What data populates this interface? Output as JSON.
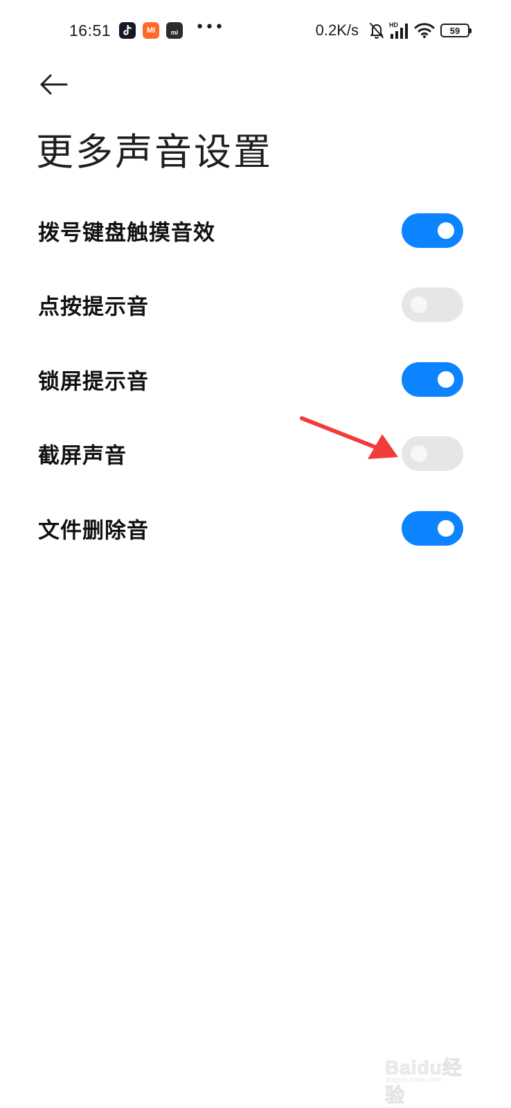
{
  "status_bar": {
    "time": "16:51",
    "app_icons": [
      "tiktok-icon",
      "mi-app-icon",
      "mi-store-icon"
    ],
    "mi_label": "MI",
    "mi_store_label": "mi",
    "more": "•••",
    "net_speed": "0.2K/s",
    "battery": "59",
    "icons": [
      "bell-off-icon",
      "hd-signal-icon",
      "wifi-icon",
      "battery-icon"
    ]
  },
  "header": {
    "back_icon": "arrow-left-icon",
    "title": "更多声音设置"
  },
  "settings": [
    {
      "label": "拨号键盘触摸音效",
      "enabled": true
    },
    {
      "label": "点按提示音",
      "enabled": false
    },
    {
      "label": "锁屏提示音",
      "enabled": true
    },
    {
      "label": "截屏声音",
      "enabled": false
    },
    {
      "label": "文件删除音",
      "enabled": true
    }
  ],
  "colors": {
    "toggle_on": "#0d84ff",
    "toggle_off": "#e6e6e6",
    "annotation": "#f23b3b"
  },
  "watermark": {
    "text": "Baidu经验",
    "url": "jingyan.baidu.com"
  }
}
